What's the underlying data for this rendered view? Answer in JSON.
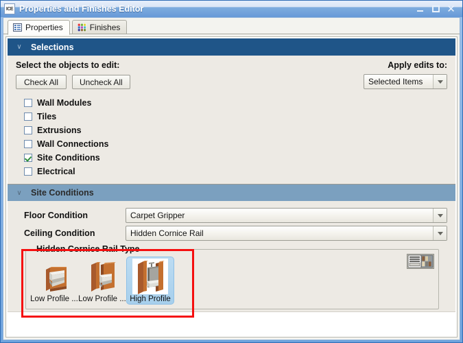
{
  "window": {
    "title": "Properties and Finishes Editor",
    "app_icon": "ICE",
    "minimize_label": "Minimize",
    "maximize_label": "Maximize",
    "close_label": "Close",
    "close_glyph": "✕"
  },
  "tabs": [
    {
      "label": "Properties",
      "icon": "list-icon",
      "active": true
    },
    {
      "label": "Finishes",
      "icon": "palette-icon",
      "active": false
    }
  ],
  "selections": {
    "header": "Selections",
    "chevron": "∨",
    "instruction": "Select the objects to edit:",
    "check_all": "Check All",
    "uncheck_all": "Uncheck All",
    "apply_label": "Apply edits to:",
    "apply_value": "Selected Items",
    "objects": [
      {
        "label": "Wall Modules",
        "checked": false
      },
      {
        "label": "Tiles",
        "checked": false
      },
      {
        "label": "Extrusions",
        "checked": false
      },
      {
        "label": "Wall Connections",
        "checked": false
      },
      {
        "label": "Site Conditions",
        "checked": true
      },
      {
        "label": "Electrical",
        "checked": false
      }
    ]
  },
  "site_conditions": {
    "header": "Site Conditions",
    "chevron": "∨",
    "floor_label": "Floor Condition",
    "floor_value": "Carpet Gripper",
    "ceiling_label": "Ceiling Condition",
    "ceiling_value": "Hidden Cornice Rail",
    "group_title": "Hidden Cornice Rail Type",
    "options": [
      {
        "label": "Low Profile ...",
        "selected": false
      },
      {
        "label": "Low Profile ...",
        "selected": false
      },
      {
        "label": "High Profile",
        "selected": true
      }
    ],
    "view_toggle": "view-toggle-icon"
  },
  "colors": {
    "titlebar_blue": "#6699d8",
    "window_border": "#2f6cb5",
    "section_primary": "#1f5588",
    "section_secondary": "#7ba0bf",
    "panel_bg": "#edeae4",
    "highlight_red": "#f50f0f",
    "selection_blue": "#a7cfec",
    "check_green": "#2f8f3c"
  }
}
